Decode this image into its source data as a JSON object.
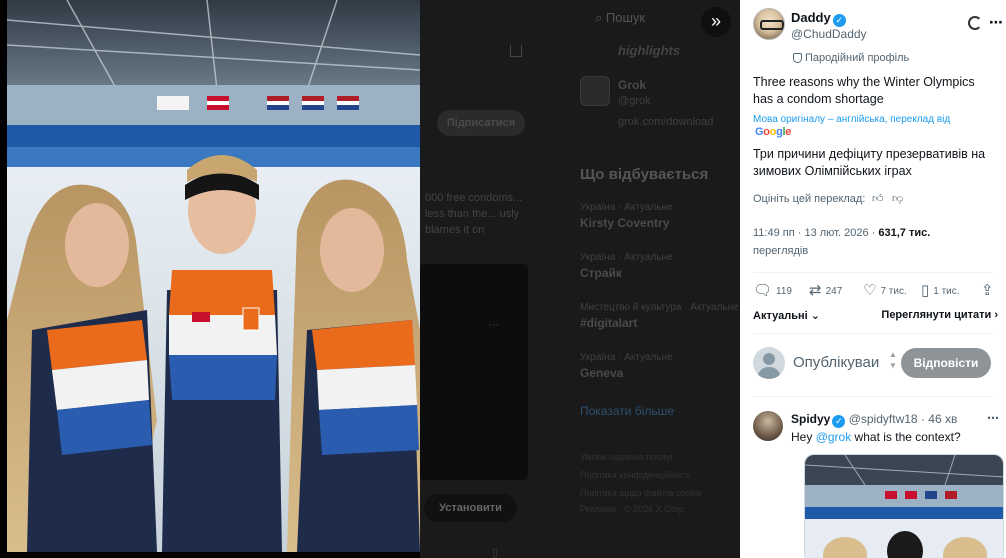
{
  "background": {
    "search_placeholder": "Пошук",
    "highlights_label": "highlights",
    "grok": {
      "name": "Grok",
      "handle": "@grok",
      "link": "grok.com/download"
    },
    "subscribe_label": "Підписатися",
    "post_excerpt": "000 free condoms... less than the... usly blames it on",
    "whats_happening": "Що відбувається",
    "trends": [
      {
        "context": "Україна · Актуальне",
        "name": "Kirsty Coventry"
      },
      {
        "context": "Україна · Актуальне",
        "name": "Страйк"
      },
      {
        "context": "Мистецтво й культура · Актуальне",
        "name": "#digitalart"
      },
      {
        "context": "Україна · Актуальне",
        "name": "Geneva"
      }
    ],
    "show_more": "Показати більше",
    "footer_lines": [
      "Умови надання послуг",
      "Політика конфіденційності",
      "Політика щодо файлів cookie",
      "Спеціальні можливості",
      "Реклама · © 2026 X Corp."
    ],
    "install_label": "Установити"
  },
  "viewer": {
    "expand_icon": "chevrons-right-icon"
  },
  "post": {
    "author_name": "Daddy",
    "author_handle": "@ChudDaddy",
    "parody_label": "Пародійний профіль",
    "text": "Three reasons why the Winter Olympics has a condom shortage",
    "translated_note": "Мова оригіналу – англійська, переклад від",
    "google_letters": [
      "G",
      "o",
      "o",
      "g",
      "l",
      "e"
    ],
    "translated_text": "Три причини дефіциту презервативів на зимових Олімпійських іграх",
    "rate_label": "Оцініть цей переклад:",
    "time": "11:49 пп · 13 лют. 2026 ·",
    "views_count": "631,7 тис.",
    "views_label": "переглядів",
    "replies": "119",
    "reposts": "247",
    "likes": "7 тис.",
    "bookmarks": "1 тис.",
    "sort_label": "Актуальні",
    "quotes_label": "Переглянути цитати"
  },
  "reply_box": {
    "placeholder": "Опублікуваи",
    "button_label": "Відповісти"
  },
  "comment": {
    "name": "Spidyy",
    "handle": "@spidyftw18",
    "time": "· 46 хв",
    "text_prefix": "Hey ",
    "mention": "@grok",
    "text_suffix": " what is the context?"
  },
  "colors": {
    "accent": "#1d9bf0",
    "text": "#0f1419",
    "muted": "#536471",
    "reply_button": "#8e9397"
  }
}
